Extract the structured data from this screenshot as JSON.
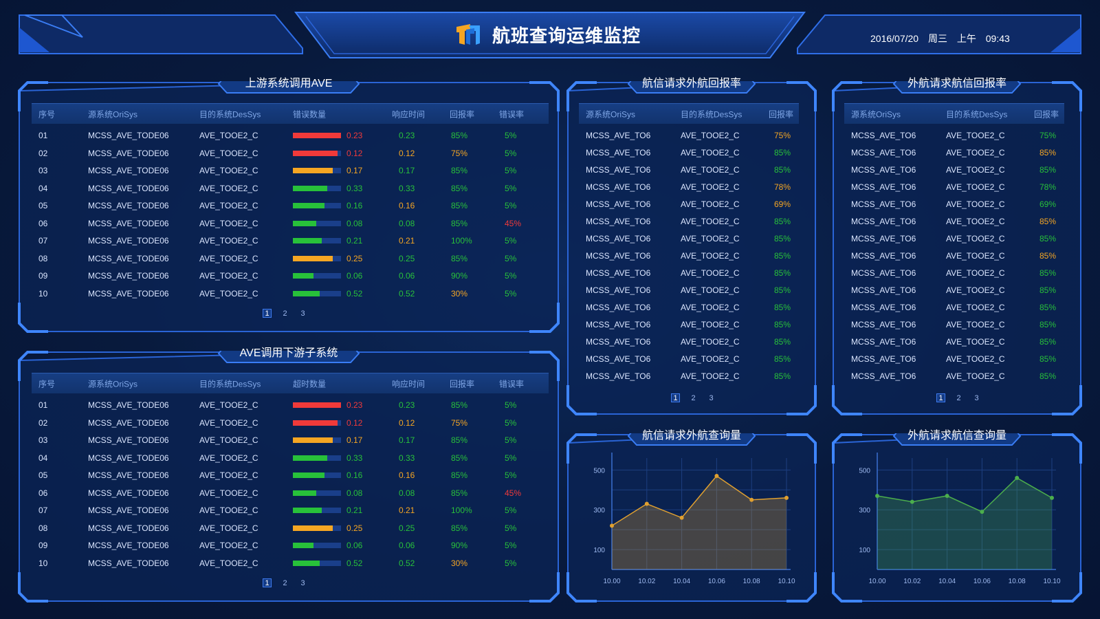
{
  "header": {
    "title": "航班查询运维监控",
    "date": "2016/07/20",
    "weekday": "周三",
    "ampm": "上午",
    "time": "09:43"
  },
  "colors": {
    "red": "#f03a3a",
    "orange": "#f5a623",
    "green": "#28c13a",
    "accent": "#2a6be6"
  },
  "panel1": {
    "title": "上游系统调用AVE",
    "columns": [
      "序号",
      "源系统OriSys",
      "目的系统DesSys",
      "错误数量",
      "响应时间",
      "回报率",
      "错误率"
    ],
    "rows": [
      {
        "no": "01",
        "src": "MCSS_AVE_TODE06",
        "dst": "AVE_TOOE2_C",
        "bar": 1.0,
        "barc": "red",
        "count": "0.23",
        "resp": "0.23",
        "respc": "green",
        "rate": "85%",
        "ratec": "green",
        "err": "5%",
        "errc": "green"
      },
      {
        "no": "02",
        "src": "MCSS_AVE_TODE06",
        "dst": "AVE_TOOE2_C",
        "bar": 0.93,
        "barc": "red",
        "count": "0.12",
        "resp": "0.12",
        "respc": "orange",
        "rate": "75%",
        "ratec": "orange",
        "err": "5%",
        "errc": "green"
      },
      {
        "no": "03",
        "src": "MCSS_AVE_TODE06",
        "dst": "AVE_TOOE2_C",
        "bar": 0.83,
        "barc": "orange",
        "count": "0.17",
        "resp": "0.17",
        "respc": "green",
        "rate": "85%",
        "ratec": "green",
        "err": "5%",
        "errc": "green"
      },
      {
        "no": "04",
        "src": "MCSS_AVE_TODE06",
        "dst": "AVE_TOOE2_C",
        "bar": 0.71,
        "barc": "green",
        "count": "0.33",
        "resp": "0.33",
        "respc": "green",
        "rate": "85%",
        "ratec": "green",
        "err": "5%",
        "errc": "green"
      },
      {
        "no": "05",
        "src": "MCSS_AVE_TODE06",
        "dst": "AVE_TOOE2_C",
        "bar": 0.66,
        "barc": "green",
        "count": "0.16",
        "resp": "0.16",
        "respc": "orange",
        "rate": "85%",
        "ratec": "green",
        "err": "5%",
        "errc": "green"
      },
      {
        "no": "06",
        "src": "MCSS_AVE_TODE06",
        "dst": "AVE_TOOE2_C",
        "bar": 0.49,
        "barc": "green",
        "count": "0.08",
        "resp": "0.08",
        "respc": "green",
        "rate": "85%",
        "ratec": "green",
        "err": "45%",
        "errc": "red"
      },
      {
        "no": "07",
        "src": "MCSS_AVE_TODE06",
        "dst": "AVE_TOOE2_C",
        "bar": 0.6,
        "barc": "green",
        "count": "0.21",
        "resp": "0.21",
        "respc": "orange",
        "rate": "100%",
        "ratec": "green",
        "err": "5%",
        "errc": "green"
      },
      {
        "no": "08",
        "src": "MCSS_AVE_TODE06",
        "dst": "AVE_TOOE2_C",
        "bar": 0.83,
        "barc": "orange",
        "count": "0.25",
        "resp": "0.25",
        "respc": "green",
        "rate": "85%",
        "ratec": "green",
        "err": "5%",
        "errc": "green"
      },
      {
        "no": "09",
        "src": "MCSS_AVE_TODE06",
        "dst": "AVE_TOOE2_C",
        "bar": 0.43,
        "barc": "green",
        "count": "0.06",
        "resp": "0.06",
        "respc": "green",
        "rate": "90%",
        "ratec": "green",
        "err": "5%",
        "errc": "green"
      },
      {
        "no": "10",
        "src": "MCSS_AVE_TODE06",
        "dst": "AVE_TOOE2_C",
        "bar": 0.56,
        "barc": "green",
        "count": "0.52",
        "resp": "0.52",
        "respc": "green",
        "rate": "30%",
        "ratec": "orange",
        "err": "5%",
        "errc": "green"
      }
    ],
    "pages": [
      "1",
      "2",
      "3"
    ]
  },
  "panel2": {
    "title": "AVE调用下游子系统",
    "columns": [
      "序号",
      "源系统OriSys",
      "目的系统DesSys",
      "超时数量",
      "响应时间",
      "回报率",
      "错误率"
    ],
    "rows": [
      {
        "no": "01",
        "src": "MCSS_AVE_TODE06",
        "dst": "AVE_TOOE2_C",
        "bar": 1.0,
        "barc": "red",
        "count": "0.23",
        "resp": "0.23",
        "respc": "green",
        "rate": "85%",
        "ratec": "green",
        "err": "5%",
        "errc": "green"
      },
      {
        "no": "02",
        "src": "MCSS_AVE_TODE06",
        "dst": "AVE_TOOE2_C",
        "bar": 0.93,
        "barc": "red",
        "count": "0.12",
        "resp": "0.12",
        "respc": "orange",
        "rate": "75%",
        "ratec": "orange",
        "err": "5%",
        "errc": "green"
      },
      {
        "no": "03",
        "src": "MCSS_AVE_TODE06",
        "dst": "AVE_TOOE2_C",
        "bar": 0.83,
        "barc": "orange",
        "count": "0.17",
        "resp": "0.17",
        "respc": "green",
        "rate": "85%",
        "ratec": "green",
        "err": "5%",
        "errc": "green"
      },
      {
        "no": "04",
        "src": "MCSS_AVE_TODE06",
        "dst": "AVE_TOOE2_C",
        "bar": 0.71,
        "barc": "green",
        "count": "0.33",
        "resp": "0.33",
        "respc": "green",
        "rate": "85%",
        "ratec": "green",
        "err": "5%",
        "errc": "green"
      },
      {
        "no": "05",
        "src": "MCSS_AVE_TODE06",
        "dst": "AVE_TOOE2_C",
        "bar": 0.66,
        "barc": "green",
        "count": "0.16",
        "resp": "0.16",
        "respc": "orange",
        "rate": "85%",
        "ratec": "green",
        "err": "5%",
        "errc": "green"
      },
      {
        "no": "06",
        "src": "MCSS_AVE_TODE06",
        "dst": "AVE_TOOE2_C",
        "bar": 0.49,
        "barc": "green",
        "count": "0.08",
        "resp": "0.08",
        "respc": "green",
        "rate": "85%",
        "ratec": "green",
        "err": "45%",
        "errc": "red"
      },
      {
        "no": "07",
        "src": "MCSS_AVE_TODE06",
        "dst": "AVE_TOOE2_C",
        "bar": 0.6,
        "barc": "green",
        "count": "0.21",
        "resp": "0.21",
        "respc": "orange",
        "rate": "100%",
        "ratec": "green",
        "err": "5%",
        "errc": "green"
      },
      {
        "no": "08",
        "src": "MCSS_AVE_TODE06",
        "dst": "AVE_TOOE2_C",
        "bar": 0.83,
        "barc": "orange",
        "count": "0.25",
        "resp": "0.25",
        "respc": "green",
        "rate": "85%",
        "ratec": "green",
        "err": "5%",
        "errc": "green"
      },
      {
        "no": "09",
        "src": "MCSS_AVE_TODE06",
        "dst": "AVE_TOOE2_C",
        "bar": 0.43,
        "barc": "green",
        "count": "0.06",
        "resp": "0.06",
        "respc": "green",
        "rate": "90%",
        "ratec": "green",
        "err": "5%",
        "errc": "green"
      },
      {
        "no": "10",
        "src": "MCSS_AVE_TODE06",
        "dst": "AVE_TOOE2_C",
        "bar": 0.56,
        "barc": "green",
        "count": "0.52",
        "resp": "0.52",
        "respc": "green",
        "rate": "30%",
        "ratec": "orange",
        "err": "5%",
        "errc": "green"
      }
    ],
    "pages": [
      "1",
      "2",
      "3"
    ]
  },
  "panel3": {
    "title": "航信请求外航回报率",
    "columns": [
      "源系统OriSys",
      "目的系统DesSys",
      "回报率"
    ],
    "rows": [
      {
        "src": "MCSS_AVE_TO6",
        "dst": "AVE_TOOE2_C",
        "rate": "75%",
        "ratec": "orange"
      },
      {
        "src": "MCSS_AVE_TO6",
        "dst": "AVE_TOOE2_C",
        "rate": "85%",
        "ratec": "green"
      },
      {
        "src": "MCSS_AVE_TO6",
        "dst": "AVE_TOOE2_C",
        "rate": "85%",
        "ratec": "green"
      },
      {
        "src": "MCSS_AVE_TO6",
        "dst": "AVE_TOOE2_C",
        "rate": "78%",
        "ratec": "orange"
      },
      {
        "src": "MCSS_AVE_TO6",
        "dst": "AVE_TOOE2_C",
        "rate": "69%",
        "ratec": "orange"
      },
      {
        "src": "MCSS_AVE_TO6",
        "dst": "AVE_TOOE2_C",
        "rate": "85%",
        "ratec": "green"
      },
      {
        "src": "MCSS_AVE_TO6",
        "dst": "AVE_TOOE2_C",
        "rate": "85%",
        "ratec": "green"
      },
      {
        "src": "MCSS_AVE_TO6",
        "dst": "AVE_TOOE2_C",
        "rate": "85%",
        "ratec": "green"
      },
      {
        "src": "MCSS_AVE_TO6",
        "dst": "AVE_TOOE2_C",
        "rate": "85%",
        "ratec": "green"
      },
      {
        "src": "MCSS_AVE_TO6",
        "dst": "AVE_TOOE2_C",
        "rate": "85%",
        "ratec": "green"
      },
      {
        "src": "MCSS_AVE_TO6",
        "dst": "AVE_TOOE2_C",
        "rate": "85%",
        "ratec": "green"
      },
      {
        "src": "MCSS_AVE_TO6",
        "dst": "AVE_TOOE2_C",
        "rate": "85%",
        "ratec": "green"
      },
      {
        "src": "MCSS_AVE_TO6",
        "dst": "AVE_TOOE2_C",
        "rate": "85%",
        "ratec": "green"
      },
      {
        "src": "MCSS_AVE_TO6",
        "dst": "AVE_TOOE2_C",
        "rate": "85%",
        "ratec": "green"
      },
      {
        "src": "MCSS_AVE_TO6",
        "dst": "AVE_TOOE2_C",
        "rate": "85%",
        "ratec": "green"
      }
    ],
    "pages": [
      "1",
      "2",
      "3"
    ]
  },
  "panel4": {
    "title": "外航请求航信回报率",
    "columns": [
      "源系统OriSys",
      "目的系统DesSys",
      "回报率"
    ],
    "rows": [
      {
        "src": "MCSS_AVE_TO6",
        "dst": "AVE_TOOE2_C",
        "rate": "75%",
        "ratec": "green"
      },
      {
        "src": "MCSS_AVE_TO6",
        "dst": "AVE_TOOE2_C",
        "rate": "85%",
        "ratec": "orange"
      },
      {
        "src": "MCSS_AVE_TO6",
        "dst": "AVE_TOOE2_C",
        "rate": "85%",
        "ratec": "green"
      },
      {
        "src": "MCSS_AVE_TO6",
        "dst": "AVE_TOOE2_C",
        "rate": "78%",
        "ratec": "green"
      },
      {
        "src": "MCSS_AVE_TO6",
        "dst": "AVE_TOOE2_C",
        "rate": "69%",
        "ratec": "green"
      },
      {
        "src": "MCSS_AVE_TO6",
        "dst": "AVE_TOOE2_C",
        "rate": "85%",
        "ratec": "orange"
      },
      {
        "src": "MCSS_AVE_TO6",
        "dst": "AVE_TOOE2_C",
        "rate": "85%",
        "ratec": "green"
      },
      {
        "src": "MCSS_AVE_TO6",
        "dst": "AVE_TOOE2_C",
        "rate": "85%",
        "ratec": "orange"
      },
      {
        "src": "MCSS_AVE_TO6",
        "dst": "AVE_TOOE2_C",
        "rate": "85%",
        "ratec": "green"
      },
      {
        "src": "MCSS_AVE_TO6",
        "dst": "AVE_TOOE2_C",
        "rate": "85%",
        "ratec": "green"
      },
      {
        "src": "MCSS_AVE_TO6",
        "dst": "AVE_TOOE2_C",
        "rate": "85%",
        "ratec": "green"
      },
      {
        "src": "MCSS_AVE_TO6",
        "dst": "AVE_TOOE2_C",
        "rate": "85%",
        "ratec": "green"
      },
      {
        "src": "MCSS_AVE_TO6",
        "dst": "AVE_TOOE2_C",
        "rate": "85%",
        "ratec": "green"
      },
      {
        "src": "MCSS_AVE_TO6",
        "dst": "AVE_TOOE2_C",
        "rate": "85%",
        "ratec": "green"
      },
      {
        "src": "MCSS_AVE_TO6",
        "dst": "AVE_TOOE2_C",
        "rate": "85%",
        "ratec": "green"
      }
    ],
    "pages": [
      "1",
      "2",
      "3"
    ]
  },
  "panel5": {
    "title": "航信请求外航查询量"
  },
  "panel6": {
    "title": "外航请求航信查询量"
  },
  "chart_data": [
    {
      "type": "area",
      "title": "航信请求外航查询量",
      "x": [
        "10.00",
        "10.02",
        "10.04",
        "10.06",
        "10.08",
        "10.10"
      ],
      "values": [
        220,
        330,
        260,
        470,
        350,
        360
      ],
      "yticks": [
        100,
        300,
        500
      ],
      "ylim": [
        0,
        560
      ],
      "grid": true,
      "color": "#e0a030"
    },
    {
      "type": "area",
      "title": "外航请求航信查询量",
      "x": [
        "10.00",
        "10.02",
        "10.04",
        "10.06",
        "10.08",
        "10.10"
      ],
      "values": [
        370,
        340,
        370,
        290,
        460,
        360
      ],
      "yticks": [
        100,
        300,
        500
      ],
      "ylim": [
        0,
        560
      ],
      "grid": true,
      "color": "#4cae4c"
    }
  ]
}
